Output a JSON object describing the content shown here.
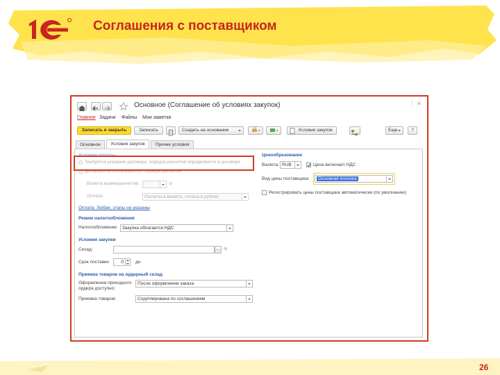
{
  "slide": {
    "title": "Соглашения с поставщиком",
    "page_number": "26"
  },
  "window": {
    "title": "Основное (Соглашение об условиях закупок)",
    "close_glyph": "×",
    "more_glyph": "⋮"
  },
  "nav_tabs": [
    "Главное",
    "Задачи",
    "Файлы",
    "Мои заметки"
  ],
  "toolbar": {
    "save_close": "Записать и закрыть",
    "save": "Записать",
    "create_based": "Создать на основании",
    "purchase_terms": "Условия закупок",
    "more": "Еще",
    "help": "?"
  },
  "tabs": [
    "Основное",
    "Условия закупок",
    "Прочие условия"
  ],
  "left": {
    "payment_section": "Условия оплаты",
    "radio1": "Требуется указание договора, порядок расчетов определяется в договоре",
    "radio2": "Договоры не используются, порядок расчетов",
    "currency_label": "Валюта взаиморасчетов:",
    "payment_label": "Оплата:",
    "payment_value": "Расчеты в валюте, оплата в рублях",
    "payment_link": "Оплата: Любая, этапы не указаны",
    "tax_section": "Режим налогообложения",
    "tax_label": "Налогообложение:",
    "tax_value": "Закупка облагается НДС",
    "purchase_section": "Условия закупки",
    "warehouse_label": "Склад:",
    "delivery_label": "Срок поставки:",
    "delivery_value": "0",
    "delivery_unit": "дн",
    "receipt_section": "Приемка товаров на ордерный склад",
    "receipt_order_label1": "Оформление приходного",
    "receipt_order_label2": "ордера доступно:",
    "receipt_order_value": "После оформления заказа",
    "receipt_goods_label": "Приемка товаров:",
    "receipt_goods_value": "Сгруппирована по соглашениям"
  },
  "right": {
    "pricing_section": "Ценообразование",
    "currency_label": "Валюта:",
    "currency_value": "RUB",
    "vat_included": "Цена включает НДС",
    "price_type_label": "Вид цены поставщика:",
    "price_type_value": "Основная колонка",
    "register_prices": "Регистрировать цены поставщика автоматически (по умолчанию)"
  },
  "colors": {
    "accent_red": "#c8251d",
    "highlight_yellow": "#ffe34d",
    "link_blue": "#2b5aa8",
    "save_button_yellow": "#ffd92e"
  }
}
